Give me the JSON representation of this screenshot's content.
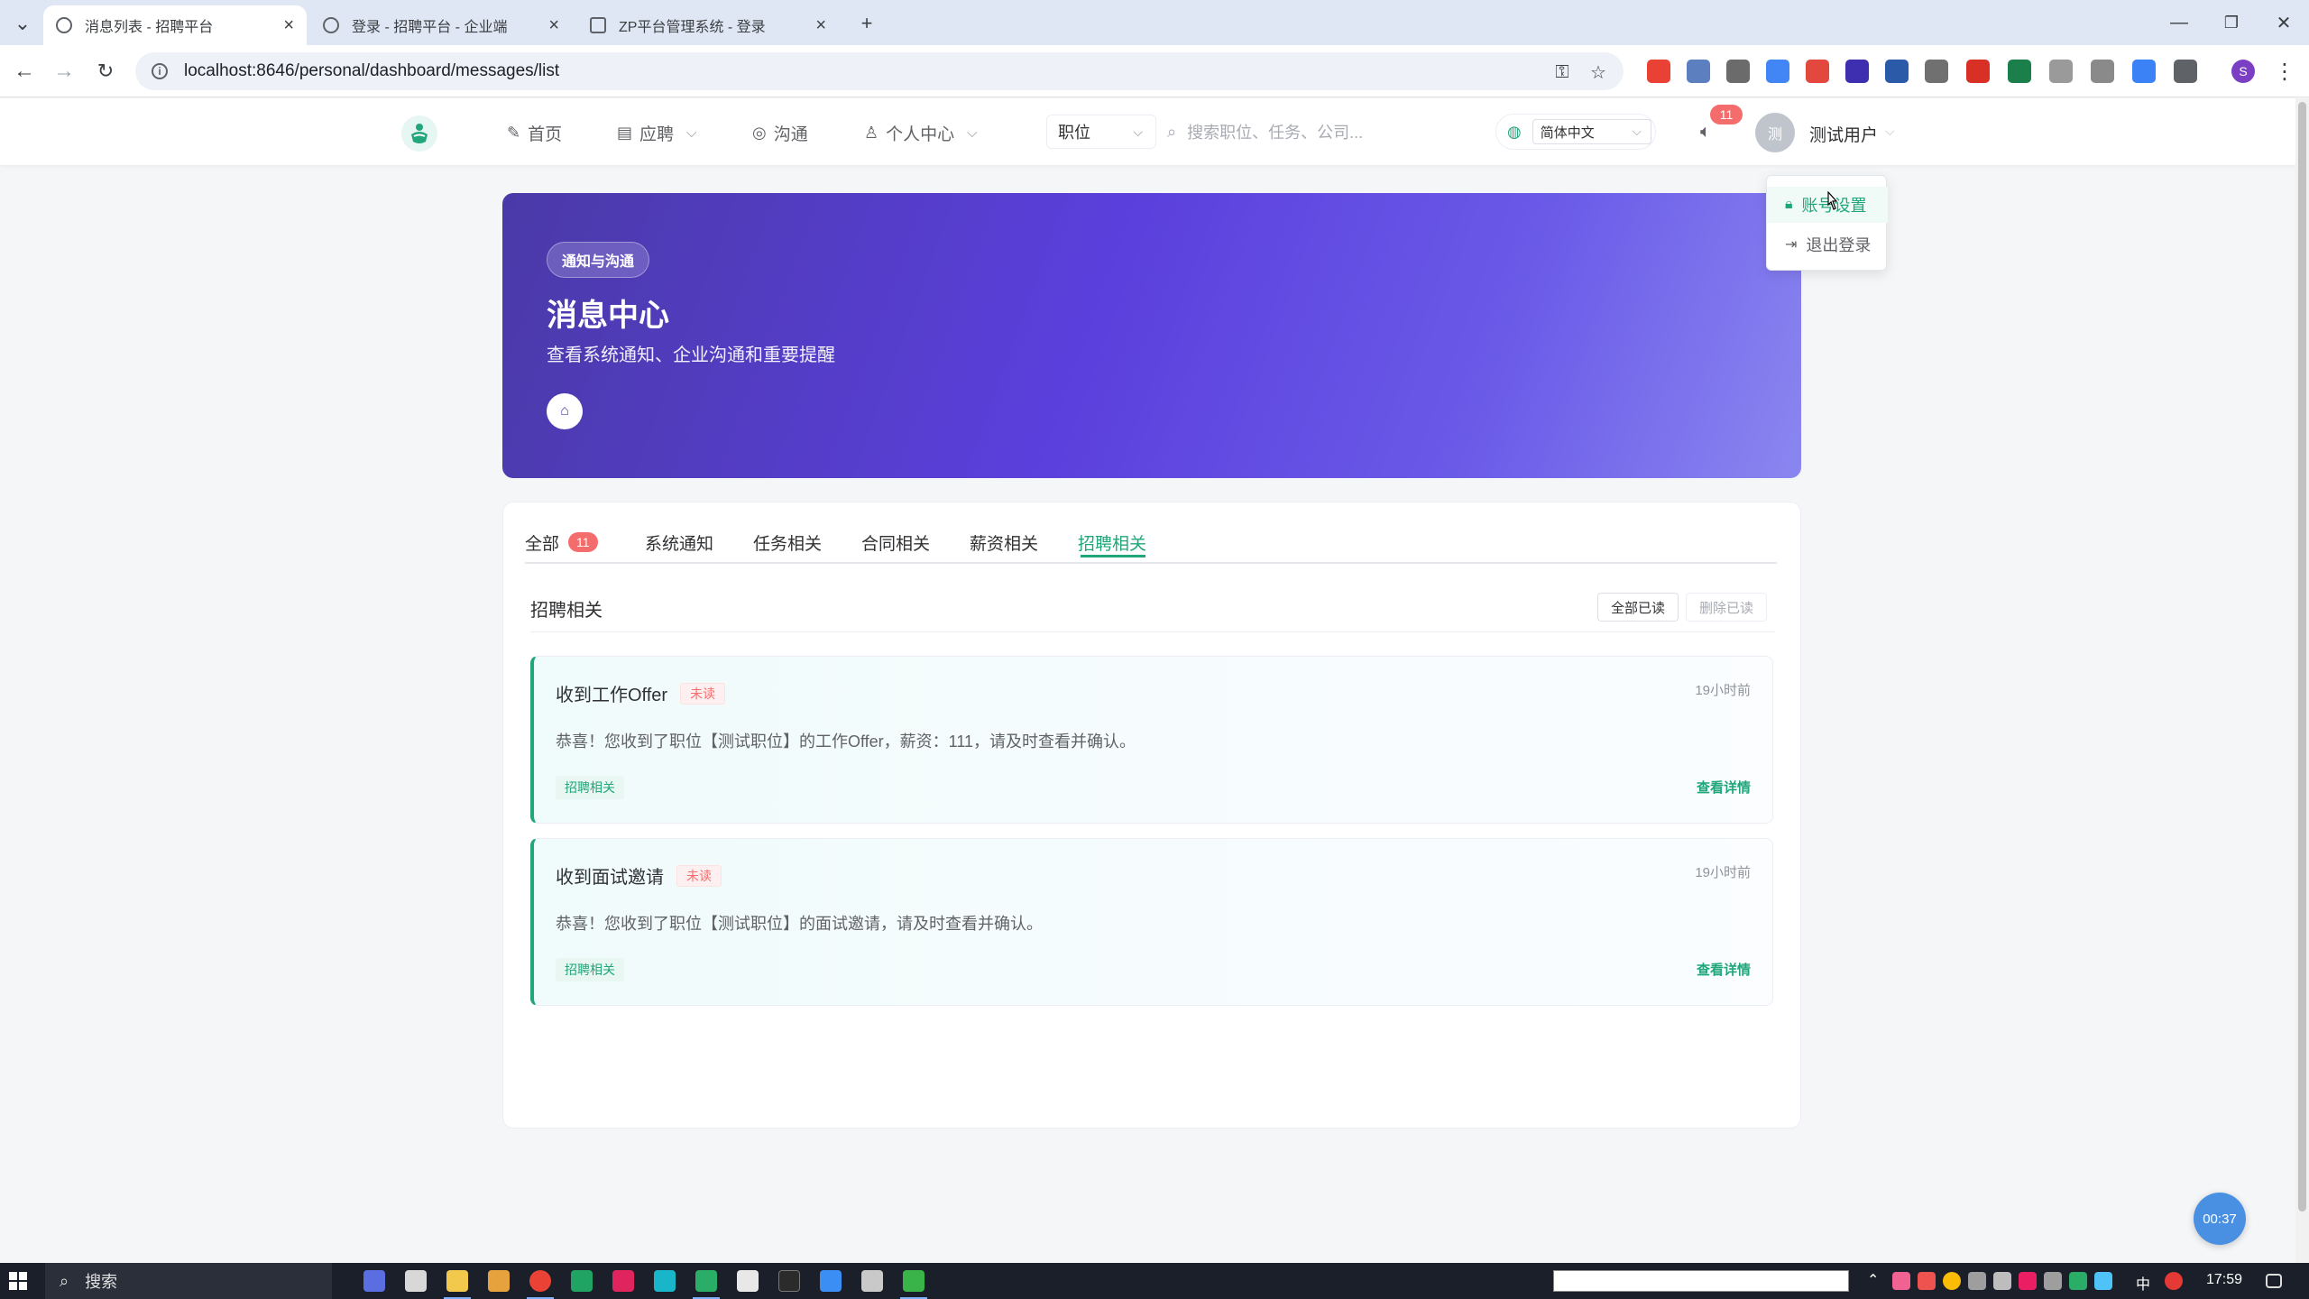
{
  "browser": {
    "tabs": [
      {
        "title": "消息列表 - 招聘平台",
        "active": true
      },
      {
        "title": "登录 - 招聘平台 - 企业端",
        "active": false
      },
      {
        "title": "ZP平台管理系统 - 登录",
        "active": false
      }
    ],
    "url": "localhost:8646/personal/dashboard/messages/list"
  },
  "header": {
    "nav": [
      {
        "label": "首页",
        "icon": "edit-icon"
      },
      {
        "label": "应聘",
        "icon": "briefcase-icon"
      },
      {
        "label": "沟通",
        "icon": "chat-icon"
      },
      {
        "label": "个人中心",
        "icon": "user-icon"
      }
    ],
    "category": "职位",
    "search_placeholder": "搜索职位、任务、公司...",
    "language": "简体中文",
    "notification_count": "11",
    "avatar_text": "测",
    "username": "测试用户",
    "user_menu": [
      {
        "label": "账号设置",
        "icon": "lock-icon"
      },
      {
        "label": "退出登录",
        "icon": "logout-icon"
      }
    ]
  },
  "hero": {
    "tag": "通知与沟通",
    "title": "消息中心",
    "subtitle": "查看系统通知、企业沟通和重要提醒"
  },
  "filters": {
    "tabs": [
      {
        "label": "全部",
        "count": "11"
      },
      {
        "label": "系统通知"
      },
      {
        "label": "任务相关"
      },
      {
        "label": "合同相关"
      },
      {
        "label": "薪资相关"
      },
      {
        "label": "招聘相关",
        "active": true
      }
    ]
  },
  "list": {
    "section_title": "招聘相关",
    "mark_all_read": "全部已读",
    "delete_read": "删除已读",
    "messages": [
      {
        "title": "收到工作Offer",
        "status": "未读",
        "time": "19小时前",
        "body": "恭喜！您收到了职位【测试职位】的工作Offer，薪资：111，请及时查看并确认。",
        "tag": "招聘相关",
        "link": "查看详情"
      },
      {
        "title": "收到面试邀请",
        "status": "未读",
        "time": "19小时前",
        "body": "恭喜！您收到了职位【测试职位】的面试邀请，请及时查看并确认。",
        "tag": "招聘相关",
        "link": "查看详情"
      }
    ]
  },
  "timer": "00:37",
  "taskbar": {
    "search": "搜索",
    "ime": "中",
    "clock": "17:59"
  },
  "colors": {
    "primary": "#21a67a",
    "danger": "#f56c6c",
    "hero_start": "#4a3aa8",
    "hero_end": "#8a86f0"
  }
}
